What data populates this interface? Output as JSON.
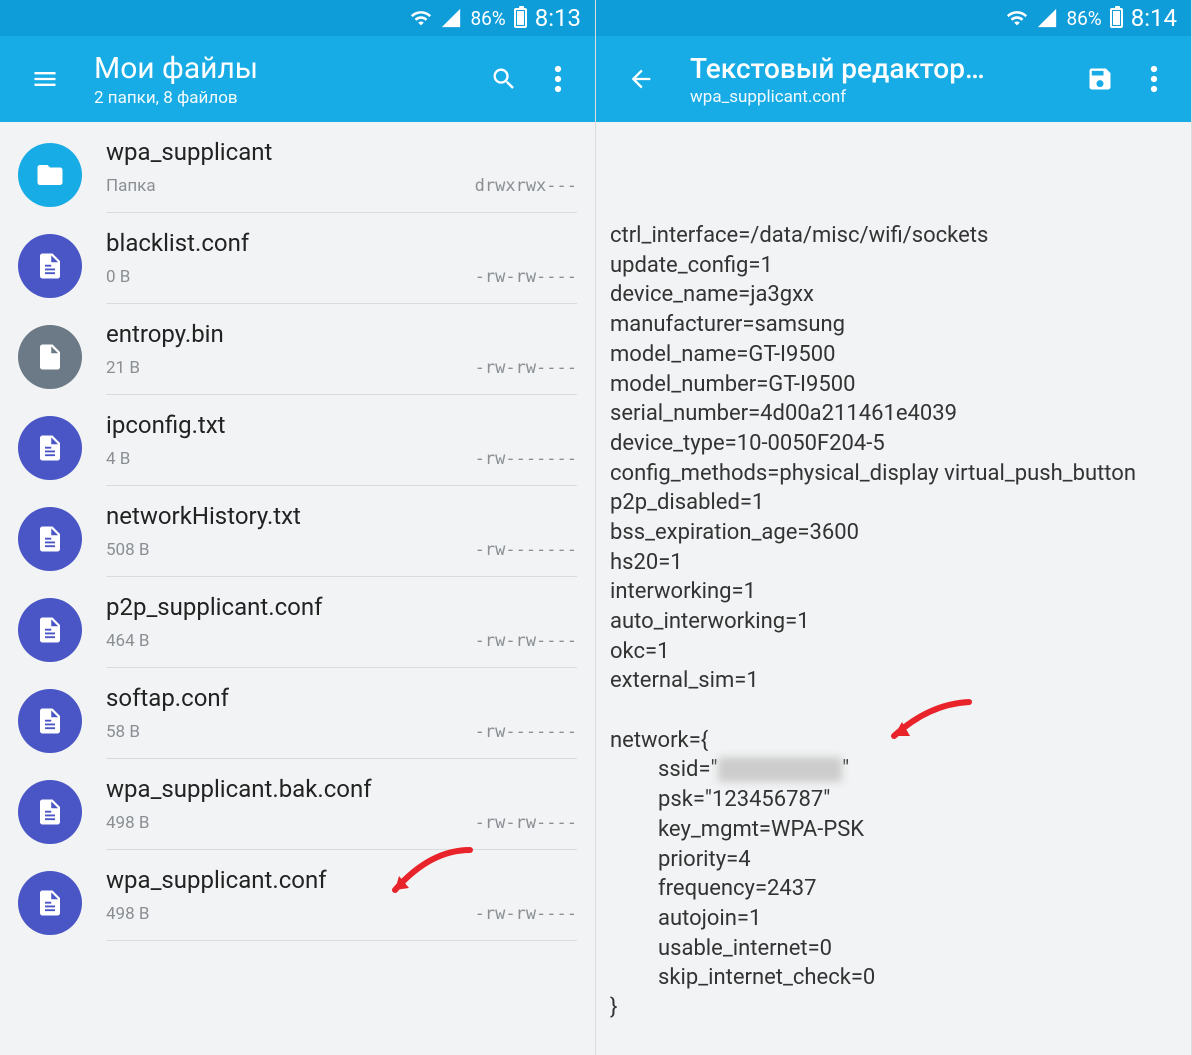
{
  "left": {
    "status": {
      "battery": "86%",
      "time": "8:13"
    },
    "appbar": {
      "title": "Мои файлы",
      "subtitle": "2 папки, 8 файлов"
    },
    "files": [
      {
        "name": "wpa_supplicant",
        "size": "Папка",
        "perms": "drwxrwx---",
        "kind": "folder"
      },
      {
        "name": "blacklist.conf",
        "size": "0 B",
        "perms": "-rw-rw----",
        "kind": "doc"
      },
      {
        "name": "entropy.bin",
        "size": "21 B",
        "perms": "-rw-rw----",
        "kind": "bin"
      },
      {
        "name": "ipconfig.txt",
        "size": "4 B",
        "perms": "-rw-------",
        "kind": "doc"
      },
      {
        "name": "networkHistory.txt",
        "size": "508 B",
        "perms": "-rw-------",
        "kind": "doc"
      },
      {
        "name": "p2p_supplicant.conf",
        "size": "464 B",
        "perms": "-rw-rw----",
        "kind": "doc"
      },
      {
        "name": "softap.conf",
        "size": "58 B",
        "perms": "-rw-------",
        "kind": "doc"
      },
      {
        "name": "wpa_supplicant.bak.conf",
        "size": "498 B",
        "perms": "-rw-rw----",
        "kind": "doc"
      },
      {
        "name": "wpa_supplicant.conf",
        "size": "498 B",
        "perms": "-rw-rw----",
        "kind": "doc"
      }
    ]
  },
  "right": {
    "status": {
      "battery": "86%",
      "time": "8:14"
    },
    "appbar": {
      "title": "Текстовый редактор…",
      "subtitle": "wpa_supplicant.conf"
    },
    "lines_head": [
      "ctrl_interface=/data/misc/wifi/sockets",
      "update_config=1",
      "device_name=ja3gxx",
      "manufacturer=samsung",
      "model_name=GT-I9500",
      "model_number=GT-I9500",
      "serial_number=4d00a211461e4039",
      "device_type=10-0050F204-5",
      "config_methods=physical_display virtual_push_button",
      "p2p_disabled=1",
      "bss_expiration_age=3600",
      "hs20=1",
      "interworking=1",
      "auto_interworking=1",
      "okc=1",
      "external_sim=1",
      "",
      "network={"
    ],
    "ssid_prefix": "ssid=\"",
    "ssid_blur": "hidden_ssid",
    "ssid_suffix": "\"",
    "lines_network": [
      "psk=\"123456787\"",
      "key_mgmt=WPA-PSK",
      "priority=4",
      "frequency=2437",
      "autojoin=1",
      "usable_internet=0",
      "skip_internet_check=0"
    ],
    "close_brace": "}"
  }
}
